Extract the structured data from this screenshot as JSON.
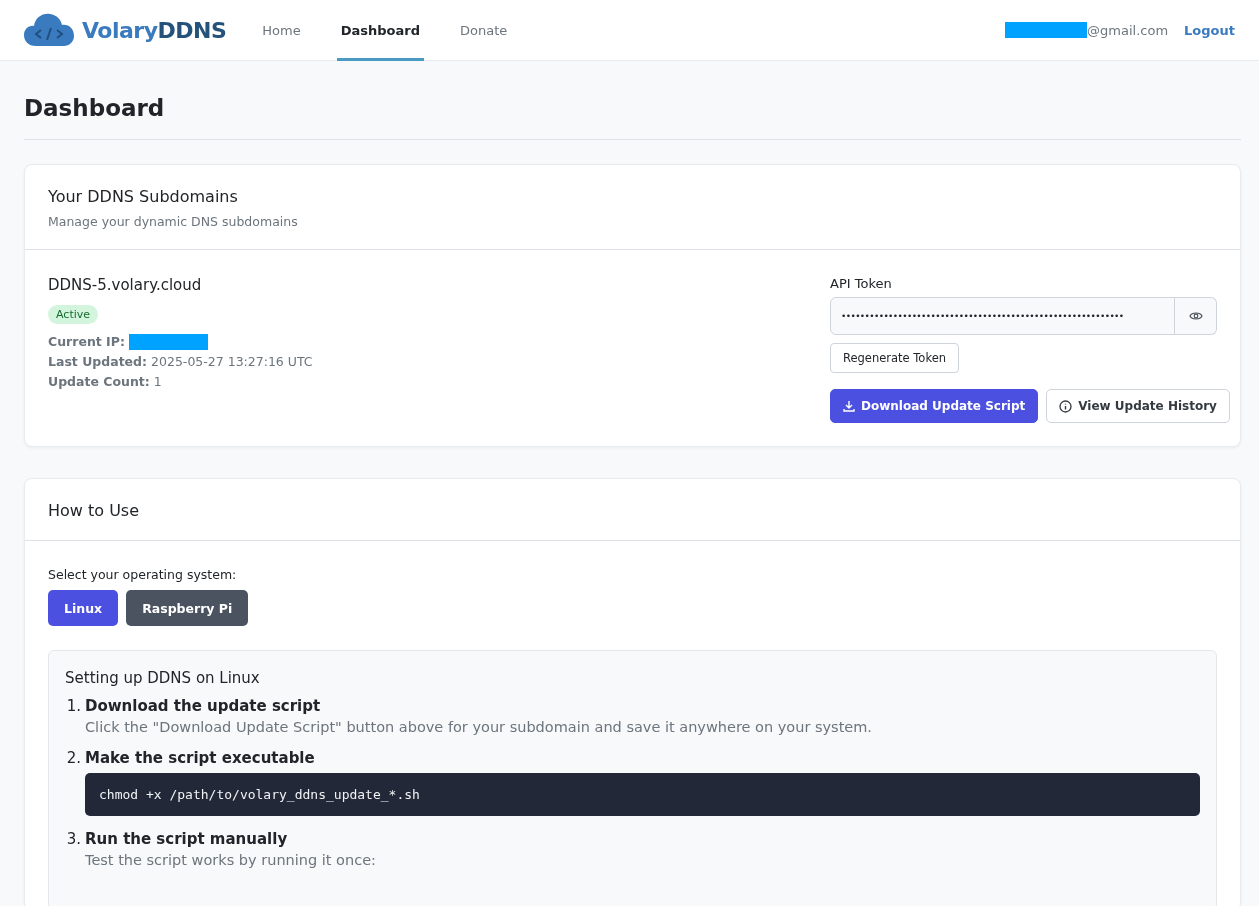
{
  "brand": {
    "name_part_1": "Volary",
    "name_part_2": "DDNS"
  },
  "nav": [
    {
      "label": "Home",
      "selected": false
    },
    {
      "label": "Dashboard",
      "selected": true
    },
    {
      "label": "Donate",
      "selected": false
    }
  ],
  "user": {
    "email_suffix": "@gmail.com",
    "logout": "Logout"
  },
  "page_title": "Dashboard",
  "subdomains_card": {
    "title": "Your DDNS Subdomains",
    "subtitle": "Manage your dynamic DNS subdomains",
    "subdomain": {
      "name": "DDNS-5.volary.cloud",
      "status": "Active",
      "details": [
        {
          "label": "Current IP:",
          "kind": "redacted"
        },
        {
          "label": "Last Updated:",
          "value": "2025-05-27 13:27:16 UTC",
          "kind": "text"
        },
        {
          "label": "Update Count:",
          "value": "1",
          "kind": "text"
        }
      ]
    },
    "token": {
      "label": "API Token",
      "value": "••••••••••••••••••••••••••••••••••••••••••••••••••••••••••••",
      "regenerate": "Regenerate Token"
    },
    "actions": [
      {
        "label": "Download Update Script",
        "kind": "primary"
      },
      {
        "label": "View Update History",
        "kind": "outline"
      }
    ]
  },
  "howto_card": {
    "title": "How to Use",
    "os_prompt": "Select your operating system:",
    "os_options": [
      {
        "label": "Linux",
        "selected": true
      },
      {
        "label": "Raspberry Pi",
        "selected": false
      }
    ],
    "guide_title": "Setting up DDNS on Linux",
    "steps": [
      {
        "number": "1.",
        "title": "Download the update script",
        "text": "Click the \"Download Update Script\" button above for your subdomain and save it anywhere on your system."
      },
      {
        "number": "2.",
        "title": "Make the script executable",
        "code": "chmod +x /path/to/volary_ddns_update_*.sh"
      },
      {
        "number": "3.",
        "title": "Run the script manually",
        "text": "Test the script works by running it once:"
      }
    ]
  }
}
